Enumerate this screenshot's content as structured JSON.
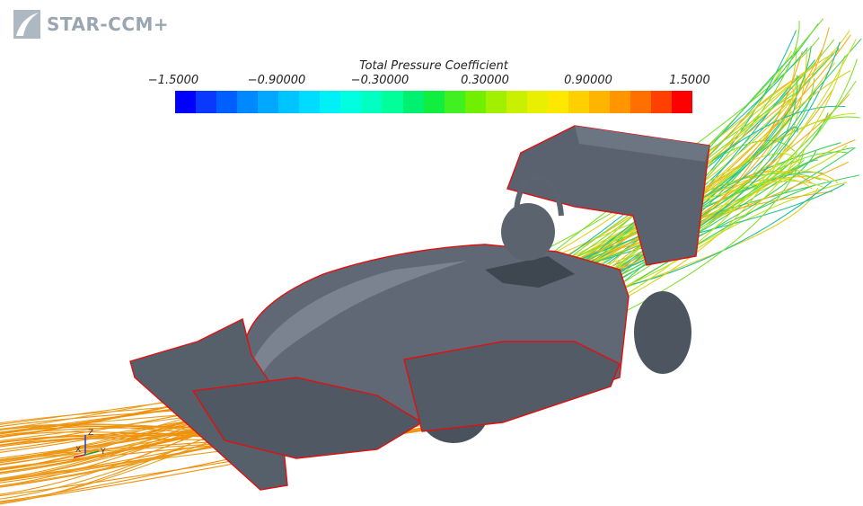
{
  "app": {
    "logo_text": "STAR-CCM+"
  },
  "legend": {
    "title": "Total Pressure Coefficient",
    "ticks": [
      "−1.5000",
      "−0.90000",
      "−0.30000",
      "0.30000",
      "0.90000",
      "1.5000"
    ],
    "colors": [
      "#0000ff",
      "#0a38ff",
      "#0060ff",
      "#0088ff",
      "#00a8ff",
      "#00c4ff",
      "#00dcff",
      "#00f0f8",
      "#00ffe0",
      "#00ffc0",
      "#00ff98",
      "#00f070",
      "#10ee40",
      "#40f020",
      "#70f000",
      "#a0f000",
      "#c8f000",
      "#e8f000",
      "#ffe800",
      "#ffd000",
      "#ffb400",
      "#ff9600",
      "#ff7000",
      "#ff4000",
      "#ff0000"
    ]
  },
  "axes_triad": {
    "x": "X",
    "y": "Y",
    "z": "Z"
  }
}
